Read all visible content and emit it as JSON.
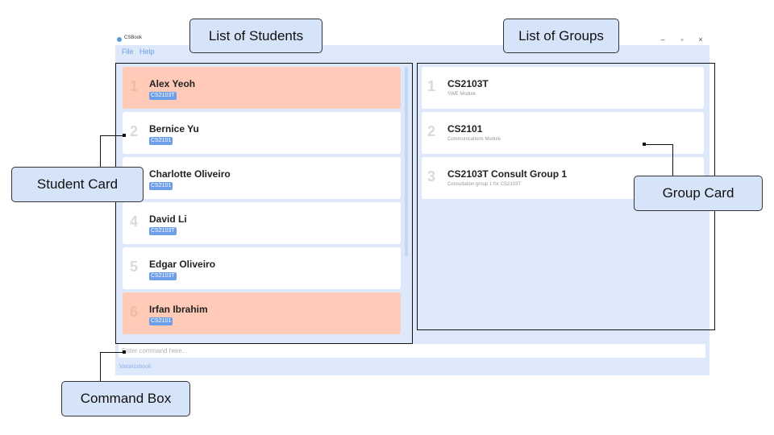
{
  "app": {
    "title": "CSBook",
    "controls": {
      "minimize": "–",
      "maximize": "▫",
      "close": "×"
    },
    "menu": [
      "File",
      "Help"
    ]
  },
  "students": [
    {
      "index": "1",
      "name": "Alex Yeoh",
      "tag": "CS2103T",
      "highlight": true
    },
    {
      "index": "2",
      "name": "Bernice Yu",
      "tag": "CS2101",
      "highlight": false
    },
    {
      "index": "3",
      "name": "Charlotte Oliveiro",
      "tag": "CS2101",
      "highlight": false
    },
    {
      "index": "4",
      "name": "David Li",
      "tag": "CS2103T",
      "highlight": false
    },
    {
      "index": "5",
      "name": "Edgar Oliveiro",
      "tag": "CS2103T",
      "highlight": false
    },
    {
      "index": "6",
      "name": "Irfan Ibrahim",
      "tag": "CS2101",
      "highlight": true
    }
  ],
  "groups": [
    {
      "index": "1",
      "name": "CS2103T",
      "description": "SWE Module"
    },
    {
      "index": "2",
      "name": "CS2101",
      "description": "Communications Module"
    },
    {
      "index": "3",
      "name": "CS2103T Consult Group 1",
      "description": "Consultation group 1 for CS2103T"
    }
  ],
  "command": {
    "placeholder": "Enter command here...",
    "value": ""
  },
  "status": {
    "path": ".\\data\\csbook"
  },
  "annotations": {
    "list_of_students": "List of Students",
    "list_of_groups": "List of Groups",
    "student_card": "Student Card",
    "group_card": "Group Card",
    "command_box": "Command Box"
  },
  "colors": {
    "accent": "#6d9ee8",
    "panel_bg": "#dde8fa",
    "highlight_card": "#ffcbb8",
    "callout_bg": "#d6e4fa"
  }
}
